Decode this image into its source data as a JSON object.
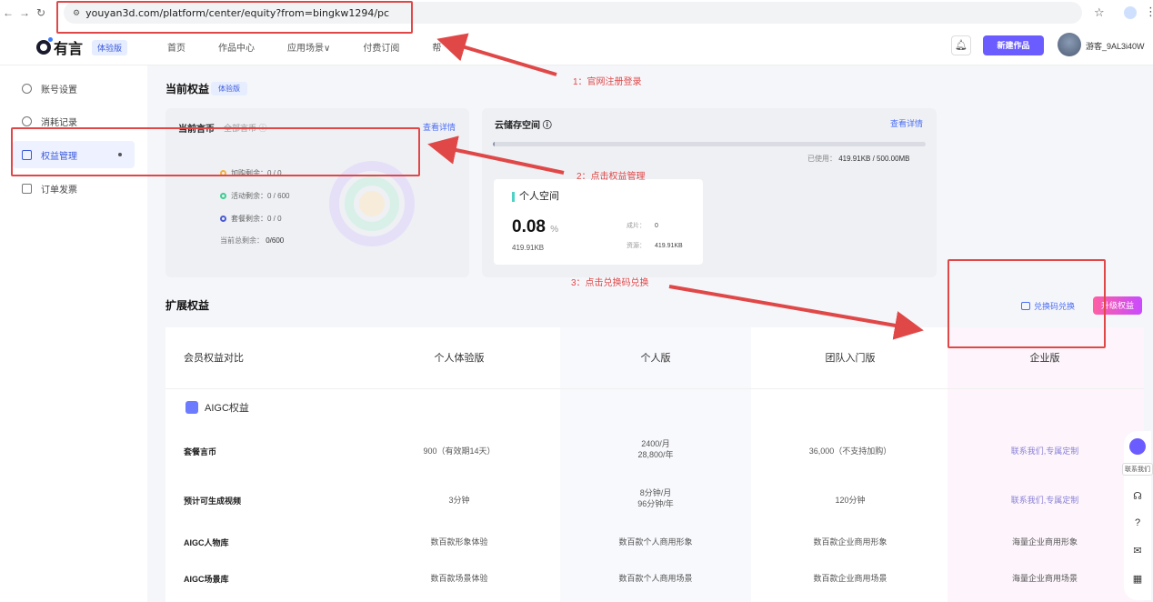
{
  "browser": {
    "url": "youyan3d.com/platform/center/equity?from=bingkw1294/pc"
  },
  "header": {
    "logo_text": "有言",
    "badge": "体验版",
    "nav": [
      "首页",
      "作品中心",
      "应用场景∨",
      "付费订阅",
      "帮"
    ],
    "new_button": "新建作品",
    "username": "游客_9AL3i40W"
  },
  "sidebar": {
    "items": [
      {
        "label": "账号设置",
        "icon": "user-icon"
      },
      {
        "label": "消耗记录",
        "icon": "clock-icon"
      },
      {
        "label": "权益管理",
        "icon": "gift-icon"
      },
      {
        "label": "订单发票",
        "icon": "invoice-icon"
      }
    ]
  },
  "main": {
    "title": "当前权益",
    "badge": "体验版",
    "coin_card": {
      "title": "当前言币",
      "subtitle": "全部言币 ⓘ",
      "link": "查看详情",
      "rows": [
        {
          "label": "加购剩余：",
          "value": "0 / 0",
          "color": "#f2b33d"
        },
        {
          "label": "活动剩余：",
          "value": "0 / 600",
          "color": "#3ccf91"
        },
        {
          "label": "套餐剩余：",
          "value": "0 / 0",
          "color": "#4c5bd4"
        }
      ],
      "total_label": "当前总剩余：",
      "total_value": "0/600"
    },
    "storage_card": {
      "title": "云储存空间 ⓘ",
      "link": "查看详情",
      "used_label": "已使用：",
      "used_value": "419.91KB / 500.00MB",
      "used_fraction": 0.0008,
      "personal_title": "个人空间",
      "percent": "0.08",
      "percent_unit": "%",
      "size": "419.91KB",
      "works_label": "成片：",
      "works_value": "0",
      "assets_label": "资源：",
      "assets_value": "419.91KB"
    }
  },
  "extension": {
    "title": "扩展权益",
    "redeem_label": "兑换码兑换",
    "upgrade_label": "升级权益"
  },
  "table": {
    "headers": [
      "会员权益对比",
      "个人体验版",
      "个人版",
      "团队入门版",
      "企业版"
    ],
    "section_label": "AIGC权益",
    "rows": [
      {
        "label": "套餐言币",
        "cells": [
          "900（有效期14天）",
          "2400/月\n28,800/年",
          "36,000（不支持加购）",
          "联系我们,专属定制"
        ]
      },
      {
        "label": "预计可生成视频",
        "cells": [
          "3分钟",
          "8分钟/月\n96分钟/年",
          "120分钟",
          "联系我们,专属定制"
        ]
      },
      {
        "label": "AIGC人物库",
        "cells": [
          "数百款形象体验",
          "数百款个人商用形象",
          "数百款企业商用形象",
          "海量企业商用形象"
        ]
      },
      {
        "label": "AIGC场景库",
        "cells": [
          "数百款场景体验",
          "数百款个人商用场景",
          "数百款企业商用场景",
          "海量企业商用场景"
        ]
      }
    ]
  },
  "float": {
    "contact_label": "联系我们"
  },
  "annotations": {
    "step1": "1：官网注册登录",
    "step2": "2：点击权益管理",
    "step3": "3：点击兑换码兑换",
    "color": "#e04848"
  }
}
